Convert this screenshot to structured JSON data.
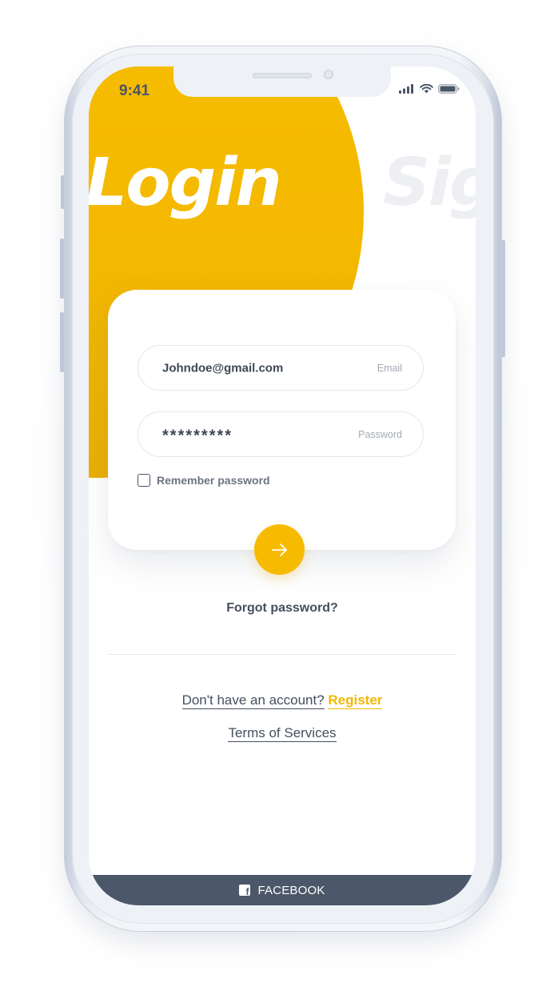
{
  "status_bar": {
    "time": "9:41"
  },
  "header": {
    "active_tab": "Login",
    "inactive_tab": "Sig"
  },
  "form": {
    "email": {
      "value": "Johndoe@gmail.com",
      "label": "Email"
    },
    "password": {
      "value": "*********",
      "label": "Password"
    },
    "remember_label": "Remember password"
  },
  "links": {
    "forgot": "Forgot password?",
    "no_account": "Don't have an account?",
    "register": "Register",
    "terms": "Terms of Services"
  },
  "social": {
    "facebook_label": "FACEBOOK"
  },
  "colors": {
    "accent": "#f6bb00",
    "dark": "#4c5869",
    "text": "#454f5e"
  },
  "icons": {
    "submit": "arrow-right-icon",
    "facebook": "facebook-icon",
    "signal": "signal-icon",
    "wifi": "wifi-icon",
    "battery": "battery-icon"
  }
}
